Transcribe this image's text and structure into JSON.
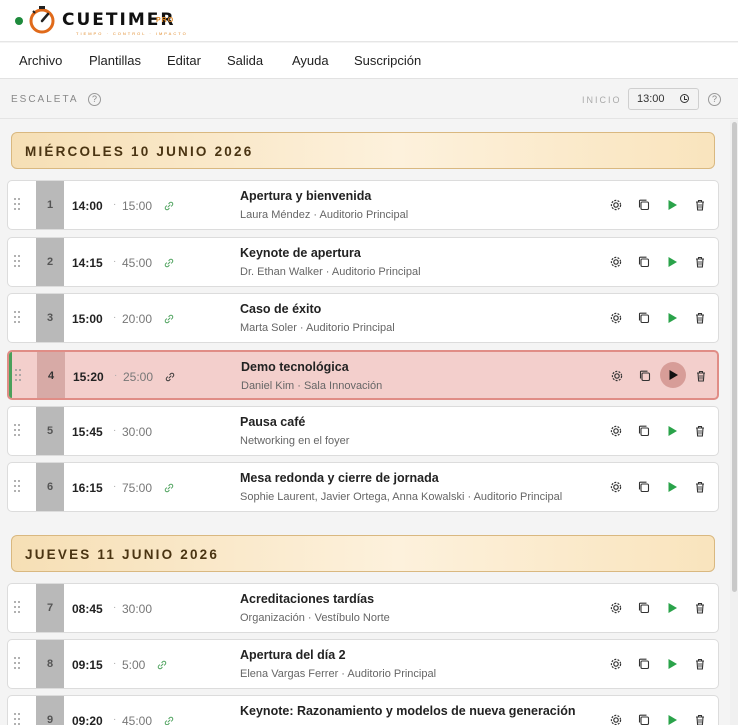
{
  "app": {
    "logo_word": "CUETIMER",
    "logo_pro": "PRO",
    "tagline": "TIEMPO · CONTROL · IMPACTO",
    "status_color": "#1e8a3c"
  },
  "menu": [
    "Archivo",
    "Plantillas",
    "Editar",
    "Salida",
    "Ayuda",
    "Suscripción"
  ],
  "escaleta": {
    "title": "ESCALETA",
    "inicio_label": "INICIO",
    "start_time": "13:00"
  },
  "days": [
    {
      "label": "MIÉRCOLES 10 JUNIO 2026",
      "cues": [
        {
          "num": "1",
          "start": "14:00",
          "duration": "15:00",
          "linked": true,
          "title": "Apertura y bienvenida",
          "subtitle": "Laura Méndez · Auditorio Principal",
          "active": false
        },
        {
          "num": "2",
          "start": "14:15",
          "duration": "45:00",
          "linked": true,
          "title": "Keynote de apertura",
          "subtitle": "Dr. Ethan Walker · Auditorio Principal",
          "active": false
        },
        {
          "num": "3",
          "start": "15:00",
          "duration": "20:00",
          "linked": true,
          "title": "Caso de éxito",
          "subtitle": "Marta Soler · Auditorio Principal",
          "active": false
        },
        {
          "num": "4",
          "start": "15:20",
          "duration": "25:00",
          "linked": true,
          "title": "Demo tecnológica",
          "subtitle": "Daniel Kim · Sala Innovación",
          "active": true
        },
        {
          "num": "5",
          "start": "15:45",
          "duration": "30:00",
          "linked": false,
          "title": "Pausa café",
          "subtitle": "Networking en el foyer",
          "active": false
        },
        {
          "num": "6",
          "start": "16:15",
          "duration": "75:00",
          "linked": true,
          "title": "Mesa redonda y cierre de jornada",
          "subtitle": "Sophie Laurent, Javier Ortega, Anna Kowalski · Auditorio Principal",
          "active": false
        }
      ]
    },
    {
      "label": "JUEVES 11 JUNIO 2026",
      "cues": [
        {
          "num": "7",
          "start": "08:45",
          "duration": "30:00",
          "linked": false,
          "title": "Acreditaciones tardías",
          "subtitle": "Organización · Vestíbulo Norte",
          "active": false
        },
        {
          "num": "8",
          "start": "09:15",
          "duration": "5:00",
          "linked": true,
          "title": "Apertura del día 2",
          "subtitle": "Elena Vargas Ferrer · Auditorio Principal",
          "active": false
        },
        {
          "num": "9",
          "start": "09:20",
          "duration": "45:00",
          "linked": true,
          "title": "Keynote: Razonamiento y modelos de nueva generación",
          "subtitle": "",
          "active": false
        }
      ]
    }
  ],
  "colors": {
    "accent_play": "#2aa34a",
    "active_row": "#f3cfcc",
    "day_header": "#f6dfb5"
  }
}
